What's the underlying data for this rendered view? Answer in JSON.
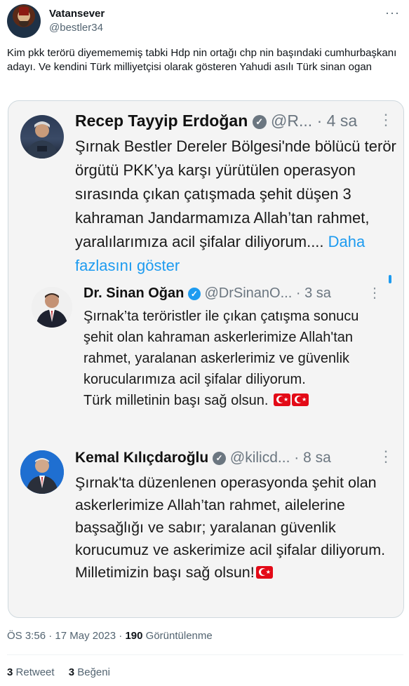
{
  "author": {
    "display_name": "Vatansever",
    "handle": "@bestler34"
  },
  "tweet": {
    "text": "Kim pkk terörü diyemememiş tabki Hdp nin ortağı chp nin başındaki cumhurbaşkanı adayı. Ve kendini Türk milliyetçisi olarak gösteren Yahudi asılı Türk sinan ogan"
  },
  "screenshot": {
    "post1": {
      "name": "Recep Tayyip Erdoğan",
      "handle": "@R...",
      "time": "4 sa",
      "text": "Şırnak Bestler Dereler Bölgesi'nde bölücü terör örgütü PKK’ya karşı yürütülen operasyon sırasında çıkan çatışmada şehit düşen 3 kahraman Jandarmamıza Allah’tan rahmet, yaralılarımıza acil şifalar diliyorum....",
      "more": "Daha fazlasını göster"
    },
    "post2": {
      "name": "Dr. Sinan Oğan",
      "handle": "@DrSinanO...",
      "time": "3 sa",
      "text": "Şırnak’ta teröristler ile çıkan çatışma sonucu şehit olan kahraman askerlerimize Allah'tan rahmet, yaralanan askerlerimiz ve güvenlik korucularımıza acil şifalar diliyorum.",
      "text2": "Türk milletinin başı sağ olsun."
    },
    "post3": {
      "name": "Kemal Kılıçdaroğlu",
      "handle": "@kilicd...",
      "time": "8 sa",
      "text": "Şırnak'ta düzenlenen operasyonda şehit olan askerlerimize Allah’tan rahmet, ailelerine başsağlığı ve sabır; yaralanan güvenlik korucumuz ve askerimize acil şifalar diliyorum. Milletimizin başı sağ olsun!"
    }
  },
  "footer": {
    "time": "ÖS 3:56",
    "date": "17 May 2023",
    "views_count": "190",
    "views_label": "Görüntülenme",
    "retweets_count": "3",
    "retweets_label": "Retweet",
    "likes_count": "3",
    "likes_label": "Beğeni"
  },
  "icons": {
    "verified": "verified-check-icon",
    "more": "more-dots-icon",
    "flag": "turkish-flag-emoji"
  },
  "colors": {
    "link": "#1d9bf0",
    "muted": "#536471",
    "flag_red": "#e30a17"
  }
}
